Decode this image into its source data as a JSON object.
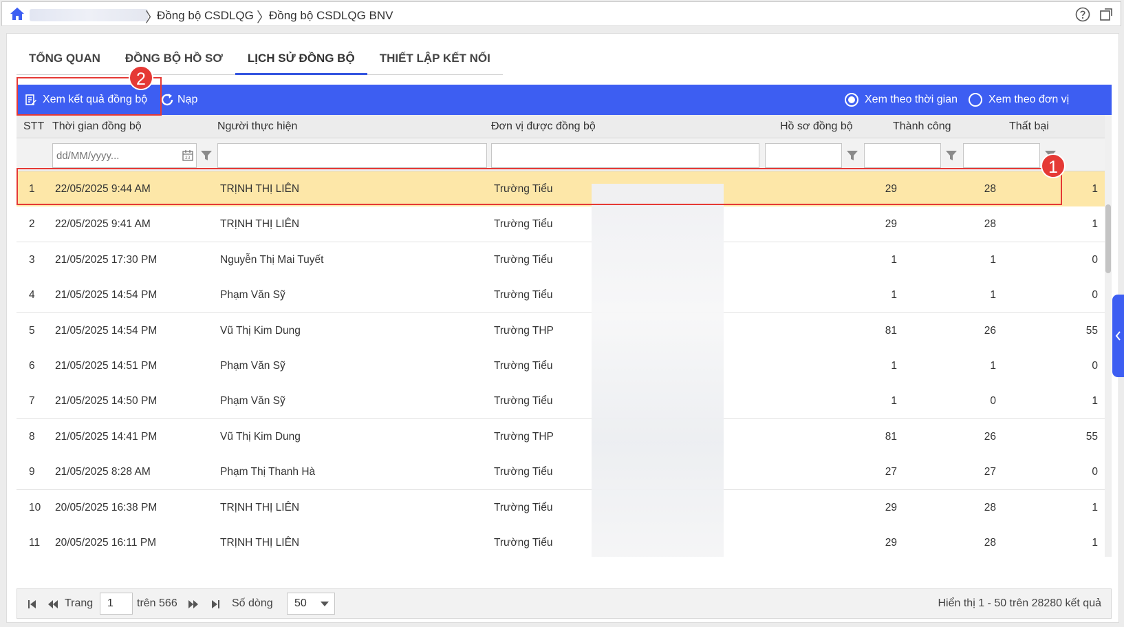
{
  "breadcrumb": {
    "items": [
      "Đồng bộ CSDLQG",
      "Đồng bộ CSDLQG BNV"
    ]
  },
  "tabs": [
    {
      "label": "TỔNG QUAN",
      "active": false
    },
    {
      "label": "ĐỒNG BỘ HỒ SƠ",
      "active": false
    },
    {
      "label": "LỊCH SỬ ĐỒNG BỘ",
      "active": true
    },
    {
      "label": "THIẾT LẬP KẾT NỐI",
      "active": false
    }
  ],
  "toolbar": {
    "view_results_label": "Xem kết quả đồng bộ",
    "reload_label": "Nạp",
    "radio_by_time_label": "Xem theo thời gian",
    "radio_by_unit_label": "Xem theo đơn vị",
    "selected_radio": "time"
  },
  "annotations": {
    "badge_1": "1",
    "badge_2": "2"
  },
  "grid": {
    "columns": {
      "stt": "STT",
      "time": "Thời gian đồng bộ",
      "user": "Người thực hiện",
      "unit": "Đơn vị được đồng bộ",
      "records": "Hồ sơ đồng bộ",
      "success": "Thành công",
      "failed": "Thất bại"
    },
    "date_filter_placeholder": "dd/MM/yyyy...",
    "rows": [
      {
        "stt": "1",
        "time": "22/05/2025 9:44 AM",
        "user": "TRỊNH THỊ LIÊN",
        "unit": "Trường Tiểu",
        "records": "29",
        "success": "28",
        "failed": "1",
        "selected": true
      },
      {
        "stt": "2",
        "time": "22/05/2025 9:41 AM",
        "user": "TRỊNH THỊ LIÊN",
        "unit": "Trường Tiểu",
        "records": "29",
        "success": "28",
        "failed": "1"
      },
      {
        "stt": "3",
        "time": "21/05/2025 17:30 PM",
        "user": "Nguyễn Thị Mai Tuyết",
        "unit": "Trường Tiểu",
        "records": "1",
        "success": "1",
        "failed": "0"
      },
      {
        "stt": "4",
        "time": "21/05/2025 14:54 PM",
        "user": "Phạm Văn Sỹ",
        "unit": "Trường Tiểu",
        "records": "1",
        "success": "1",
        "failed": "0"
      },
      {
        "stt": "5",
        "time": "21/05/2025 14:54 PM",
        "user": "Vũ Thị Kim Dung",
        "unit": "Trường THP",
        "records": "81",
        "success": "26",
        "failed": "55"
      },
      {
        "stt": "6",
        "time": "21/05/2025 14:51 PM",
        "user": "Phạm Văn Sỹ",
        "unit": "Trường Tiểu",
        "records": "1",
        "success": "1",
        "failed": "0"
      },
      {
        "stt": "7",
        "time": "21/05/2025 14:50 PM",
        "user": "Phạm Văn Sỹ",
        "unit": "Trường Tiểu",
        "records": "1",
        "success": "0",
        "failed": "1"
      },
      {
        "stt": "8",
        "time": "21/05/2025 14:41 PM",
        "user": "Vũ Thị Kim Dung",
        "unit": "Trường THP",
        "records": "81",
        "success": "26",
        "failed": "55"
      },
      {
        "stt": "9",
        "time": "21/05/2025 8:28 AM",
        "user": "Phạm Thị Thanh Hà",
        "unit": "Trường Tiểu",
        "records": "27",
        "success": "27",
        "failed": "0"
      },
      {
        "stt": "10",
        "time": "20/05/2025 16:38 PM",
        "user": "TRỊNH THỊ LIÊN",
        "unit": "Trường Tiểu",
        "records": "29",
        "success": "28",
        "failed": "1"
      },
      {
        "stt": "11",
        "time": "20/05/2025 16:11 PM",
        "user": "TRỊNH THỊ LIÊN",
        "unit": "Trường Tiểu",
        "records": "29",
        "success": "28",
        "failed": "1"
      }
    ]
  },
  "pager": {
    "page_label": "Trang",
    "current_page": "1",
    "of_label": "trên 566",
    "rows_label": "Số dòng",
    "page_size": "50",
    "summary": "Hiển thị 1 - 50 trên 28280 kết quả"
  },
  "colors": {
    "accent": "#3d5ef2",
    "selected_row": "#fde7a8",
    "annotation_red": "#e53935"
  }
}
